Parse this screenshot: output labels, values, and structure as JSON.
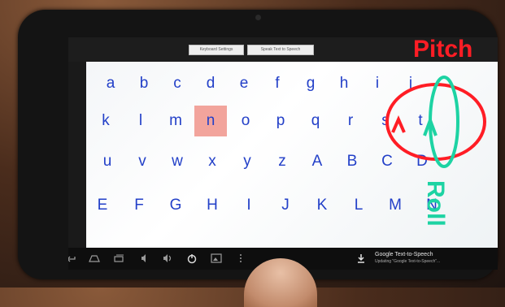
{
  "topbar": {
    "left_button": "Keyboard Settings",
    "right_button": "Speak Text to Speech"
  },
  "keyboard": {
    "rows": [
      [
        "a",
        "b",
        "c",
        "d",
        "e",
        "f",
        "g",
        "h",
        "i",
        "j"
      ],
      [
        "k",
        "l",
        "m",
        "n",
        "o",
        "p",
        "q",
        "r",
        "s",
        "t"
      ],
      [
        "u",
        "v",
        "w",
        "x",
        "y",
        "z",
        "A",
        "B",
        "C",
        "D"
      ],
      [
        "E",
        "F",
        "G",
        "H",
        "I",
        "J",
        "K",
        "L",
        "M",
        "N"
      ]
    ],
    "highlighted_key": "n",
    "text_color": "#2340c8",
    "highlight_color": "#f2a49c"
  },
  "navbar": {
    "icons": [
      "back-icon",
      "home-icon",
      "recent-apps-icon",
      "volume-down-icon",
      "volume-up-icon",
      "power-icon",
      "screenshot-icon",
      "menu-icon"
    ],
    "notification": {
      "title": "Google Text-to-Speech",
      "subtitle": "Updating \"Google Text-to-Speech\"..."
    }
  },
  "annotations": {
    "pitch_label": "Pitch",
    "roll_label": "Roll",
    "pitch_color": "#ff1d25",
    "roll_color": "#1dd3a3"
  }
}
